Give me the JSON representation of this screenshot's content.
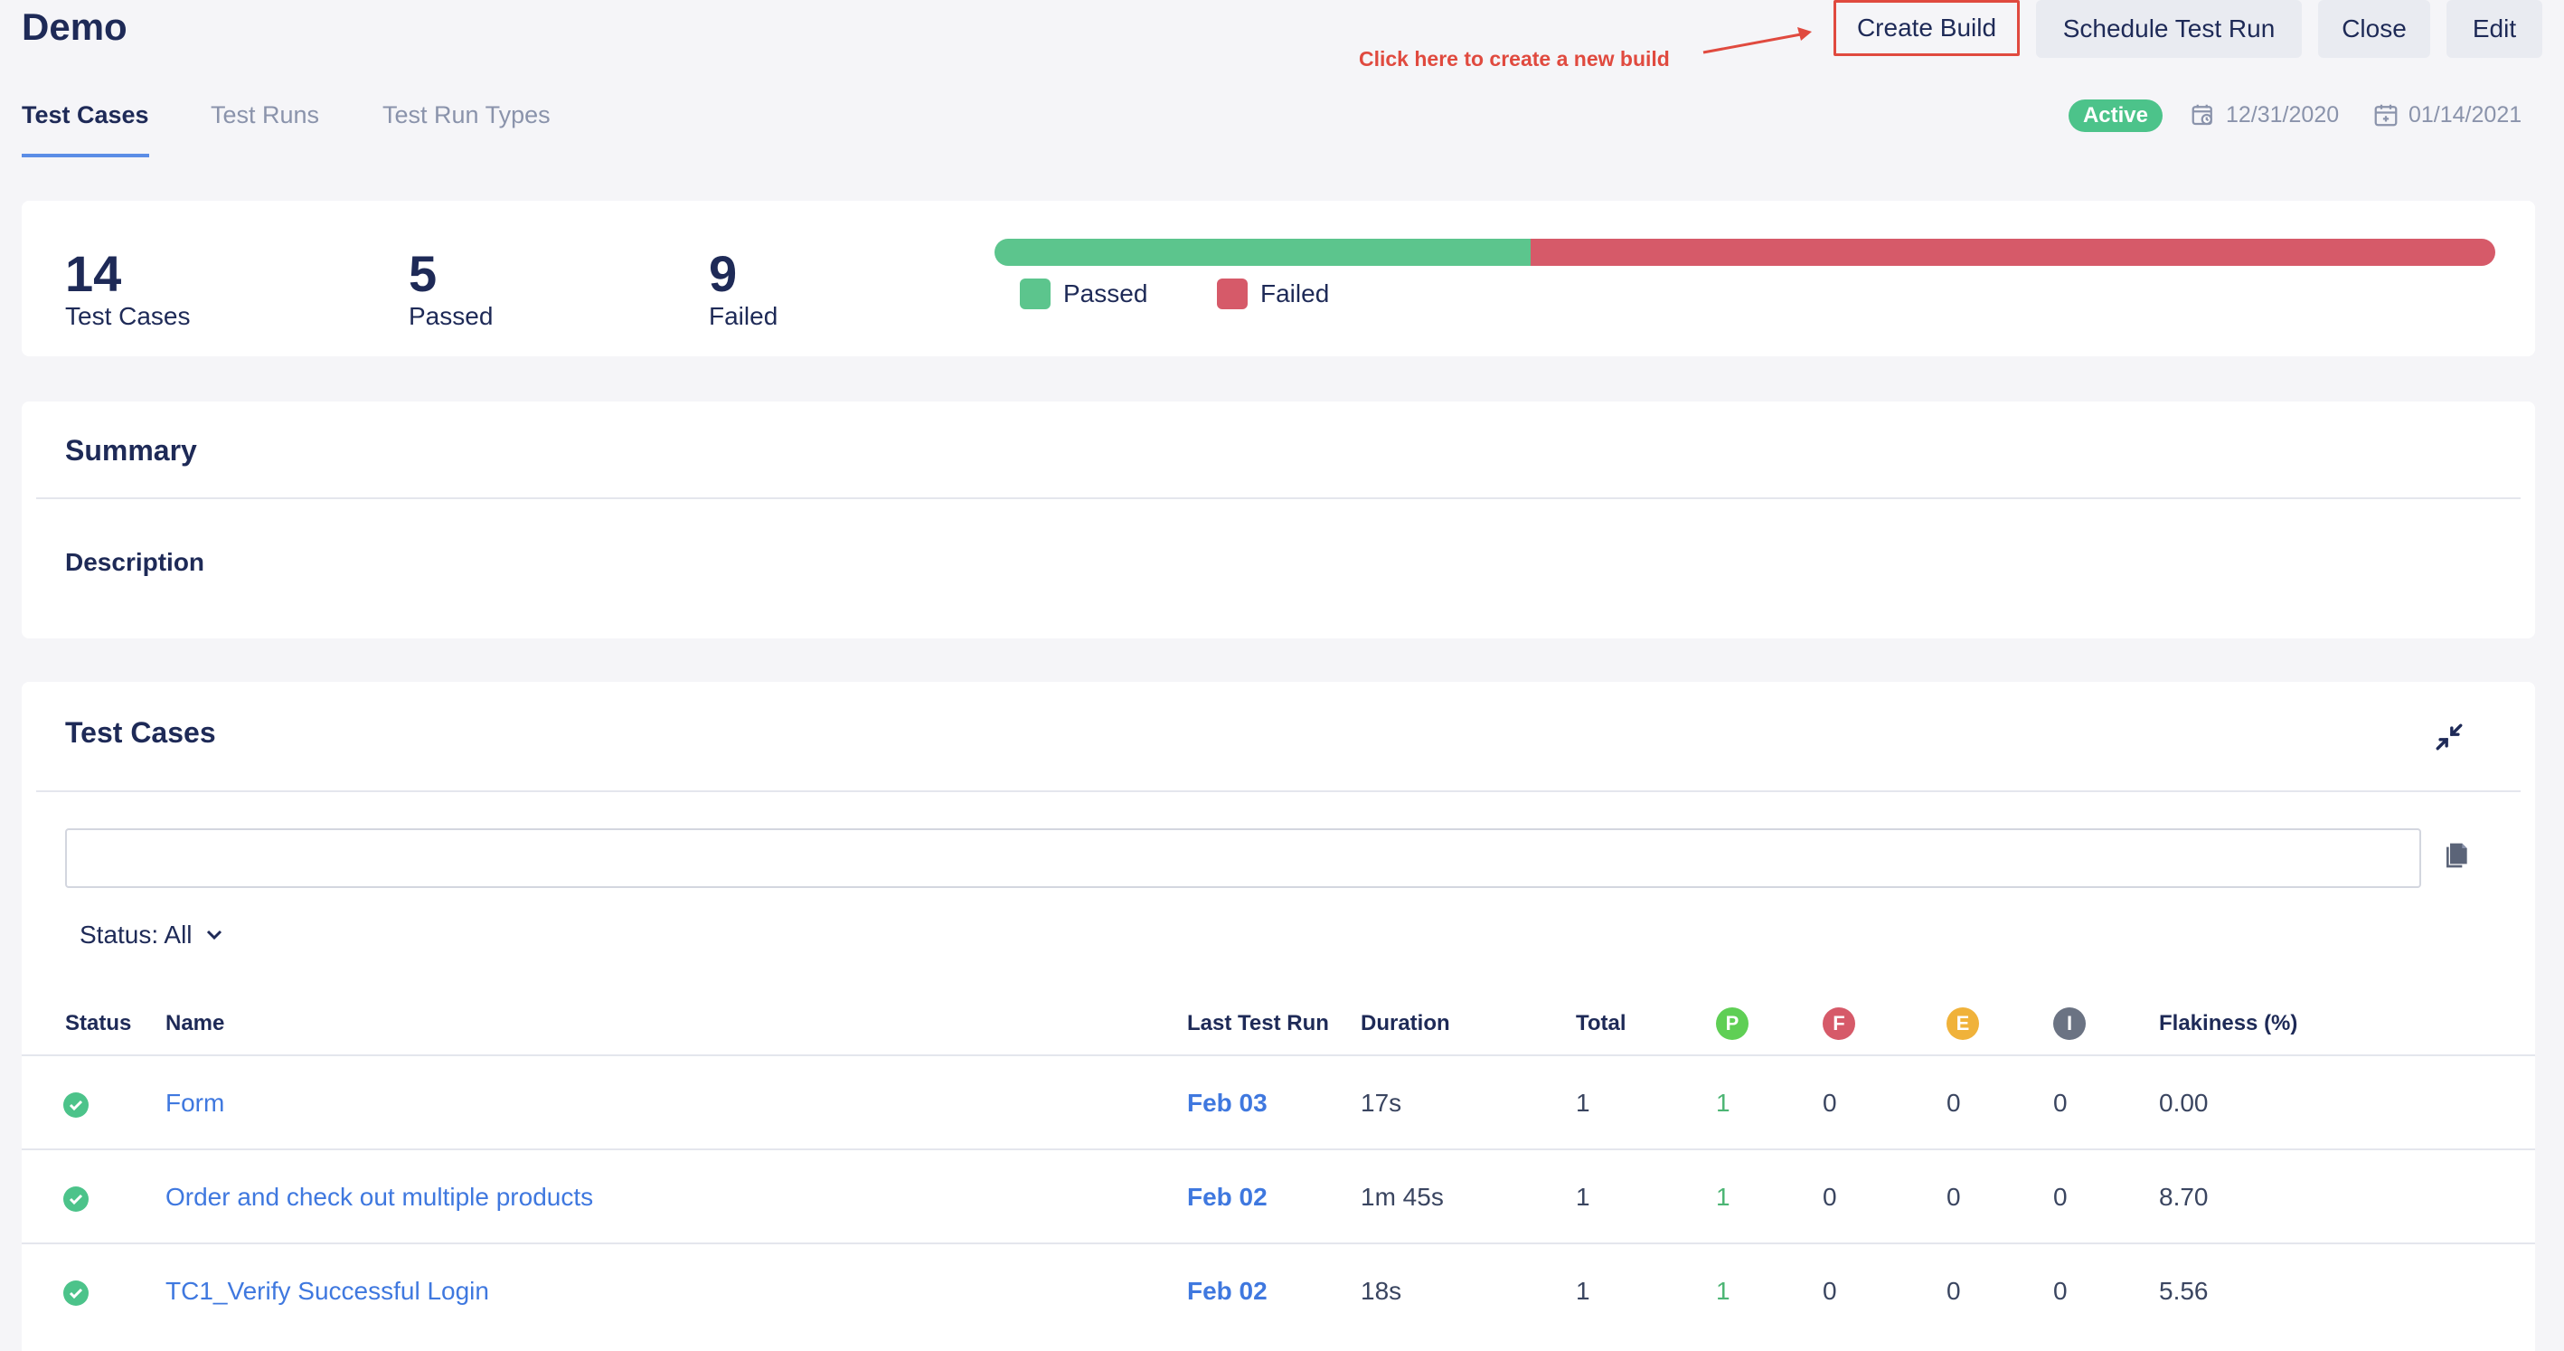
{
  "header": {
    "title": "Demo",
    "buttons": {
      "create_build": "Create Build",
      "schedule_test_run": "Schedule Test Run",
      "close": "Close",
      "edit": "Edit"
    },
    "annotation": "Click here to create a new build"
  },
  "tabs": [
    "Test Cases",
    "Test Runs",
    "Test Run Types"
  ],
  "status_badge": "Active",
  "dates": {
    "start": "12/31/2020",
    "end": "01/14/2021"
  },
  "stats": {
    "test_cases": {
      "value": "14",
      "label": "Test Cases"
    },
    "passed": {
      "value": "5",
      "label": "Passed"
    },
    "failed": {
      "value": "9",
      "label": "Failed"
    },
    "progress": {
      "passed": 5,
      "failed": 9
    },
    "legend": {
      "passed": "Passed",
      "failed": "Failed"
    }
  },
  "colors": {
    "passed": "#5cc58d",
    "failed": "#d65a69",
    "error": "#f0b23a",
    "ignored": "#6b7383",
    "pass_circle": "#5fcf55",
    "accent": "#3f78df"
  },
  "summary": {
    "title": "Summary",
    "description_label": "Description"
  },
  "test_cases": {
    "title": "Test Cases",
    "search_placeholder": "",
    "status_filter": "Status: All",
    "columns": {
      "status": "Status",
      "name": "Name",
      "last_test_run": "Last Test Run",
      "duration": "Duration",
      "total": "Total",
      "p": "P",
      "f": "F",
      "e": "E",
      "i": "I",
      "flakiness": "Flakiness (%)"
    },
    "rows": [
      {
        "status": "passed",
        "name": "Form",
        "last_test_run": "Feb 03",
        "duration": "17s",
        "total": "1",
        "p": "1",
        "f": "0",
        "e": "0",
        "i": "0",
        "flakiness": "0.00"
      },
      {
        "status": "passed",
        "name": "Order and check out multiple products",
        "last_test_run": "Feb 02",
        "duration": "1m 45s",
        "total": "1",
        "p": "1",
        "f": "0",
        "e": "0",
        "i": "0",
        "flakiness": "8.70"
      },
      {
        "status": "passed",
        "name": "TC1_Verify Successful Login",
        "last_test_run": "Feb 02",
        "duration": "18s",
        "total": "1",
        "p": "1",
        "f": "0",
        "e": "0",
        "i": "0",
        "flakiness": "5.56"
      }
    ]
  }
}
